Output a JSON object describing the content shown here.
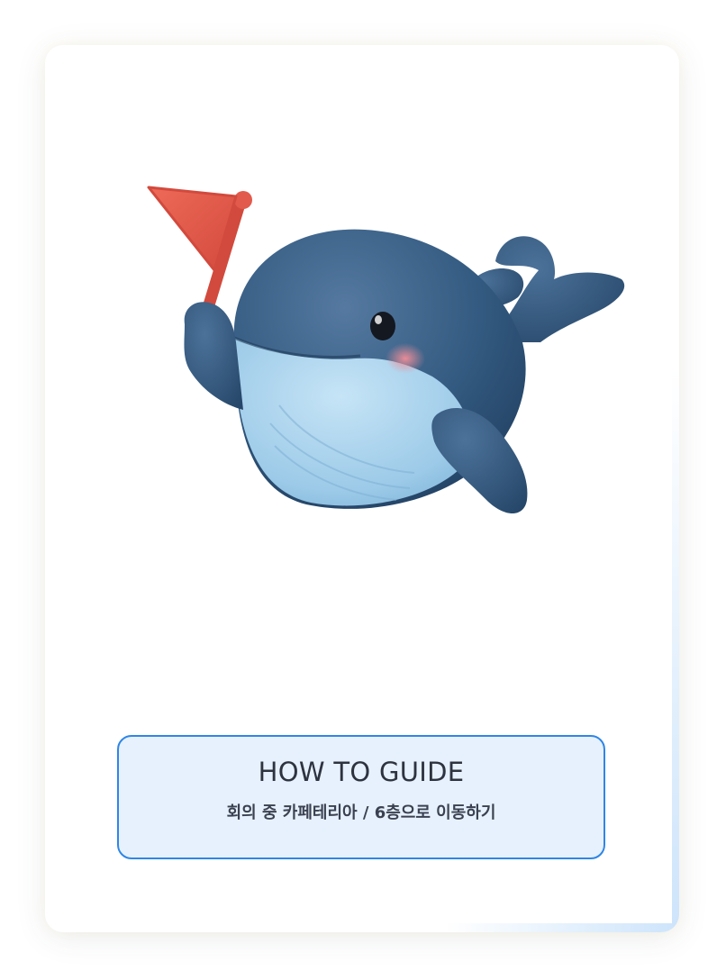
{
  "guide": {
    "title": "HOW TO GUIDE",
    "subtitle": "회의 중 카페테리아 / 6층으로 이동하기"
  },
  "illustration": {
    "subject": "whale-mascot",
    "icons": [
      "whale-mascot-icon",
      "flag-icon"
    ]
  },
  "colors": {
    "whale_body": "#2f5478",
    "whale_belly": "#a9d2ec",
    "flag": "#e0584a",
    "accent_border": "#2f86e6",
    "box_background": "#e6f1fd",
    "text": "#2e3340"
  }
}
